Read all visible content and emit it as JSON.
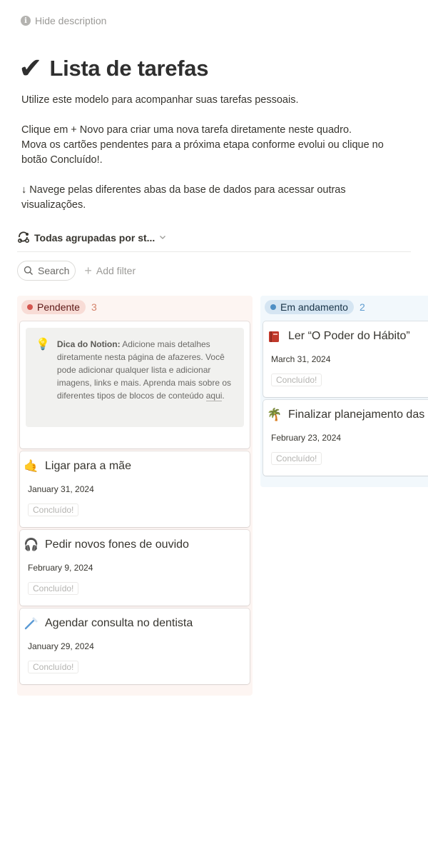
{
  "header": {
    "hide_description": "Hide description",
    "title": "Lista de tarefas"
  },
  "description": {
    "line1": "Utilize este modelo para acompanhar suas tarefas pessoais.",
    "line2": "Clique em + Novo para criar uma nova tarefa diretamente neste quadro.",
    "line3": "Mova os cartões pendentes para a próxima etapa conforme evolui ou clique no botão Concluído!.",
    "line4": "↓ Navege pelas diferentes abas da base de dados para acessar outras visualizações."
  },
  "view": {
    "label": "Todas agrupadas por st..."
  },
  "filters": {
    "search_label": "Search",
    "add_filter_label": "Add filter"
  },
  "columns": {
    "pending": {
      "label": "Pendente",
      "count": "3",
      "color": "#d4564f",
      "tip": {
        "bold": "Dica do Notion:",
        "text": " Adicione mais detalhes diretamente nesta página de afazeres. Você pode adicionar qualquer lista e adicionar imagens, links e mais. Aprenda mais sobre os diferentes tipos de blocos de conteúdo ",
        "link": "aqui",
        "end": "."
      },
      "cards": [
        {
          "icon": "call-me-hand-icon",
          "title": "Ligar para a mãe",
          "date": "January 31, 2024",
          "button": "Concluído!"
        },
        {
          "icon": "headphones-icon",
          "title": "Pedir novos fones de ouvido",
          "date": "February 9, 2024",
          "button": "Concluído!"
        },
        {
          "icon": "toothbrush-icon",
          "title": "Agendar consulta no dentista",
          "date": "January 29, 2024",
          "button": "Concluído!"
        }
      ]
    },
    "in_progress": {
      "label": "Em andamento",
      "count": "2",
      "color": "#4f8fc4",
      "cards": [
        {
          "icon": "red-book-icon",
          "title": "Ler “O Poder do Hábito”",
          "date": "March 31, 2024",
          "button": "Concluído!"
        },
        {
          "icon": "palm-tree-icon",
          "title": "Finalizar planejamento das",
          "date": "February 23, 2024",
          "button": "Concluído!"
        }
      ]
    }
  }
}
